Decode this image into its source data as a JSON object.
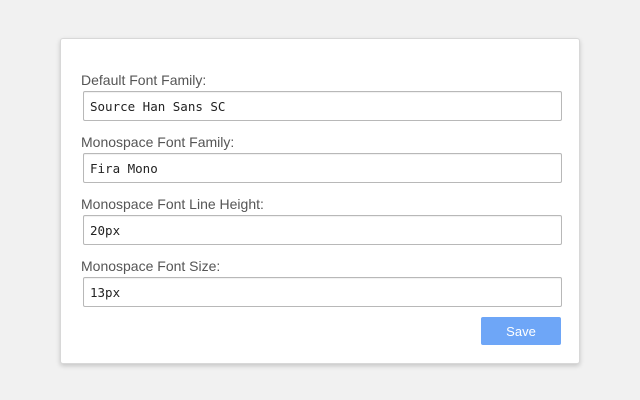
{
  "settings": {
    "default_font_family": {
      "label": "Default Font Family:",
      "value": "Source Han Sans SC"
    },
    "monospace_font_family": {
      "label": "Monospace Font Family:",
      "value": "Fira Mono"
    },
    "monospace_line_height": {
      "label": "Monospace Font Line Height:",
      "value": "20px"
    },
    "monospace_font_size": {
      "label": "Monospace Font Size:",
      "value": "13px"
    }
  },
  "actions": {
    "save_label": "Save"
  },
  "colors": {
    "accent": "#6ea6f7",
    "background": "#f1f1f1",
    "card": "#ffffff"
  }
}
